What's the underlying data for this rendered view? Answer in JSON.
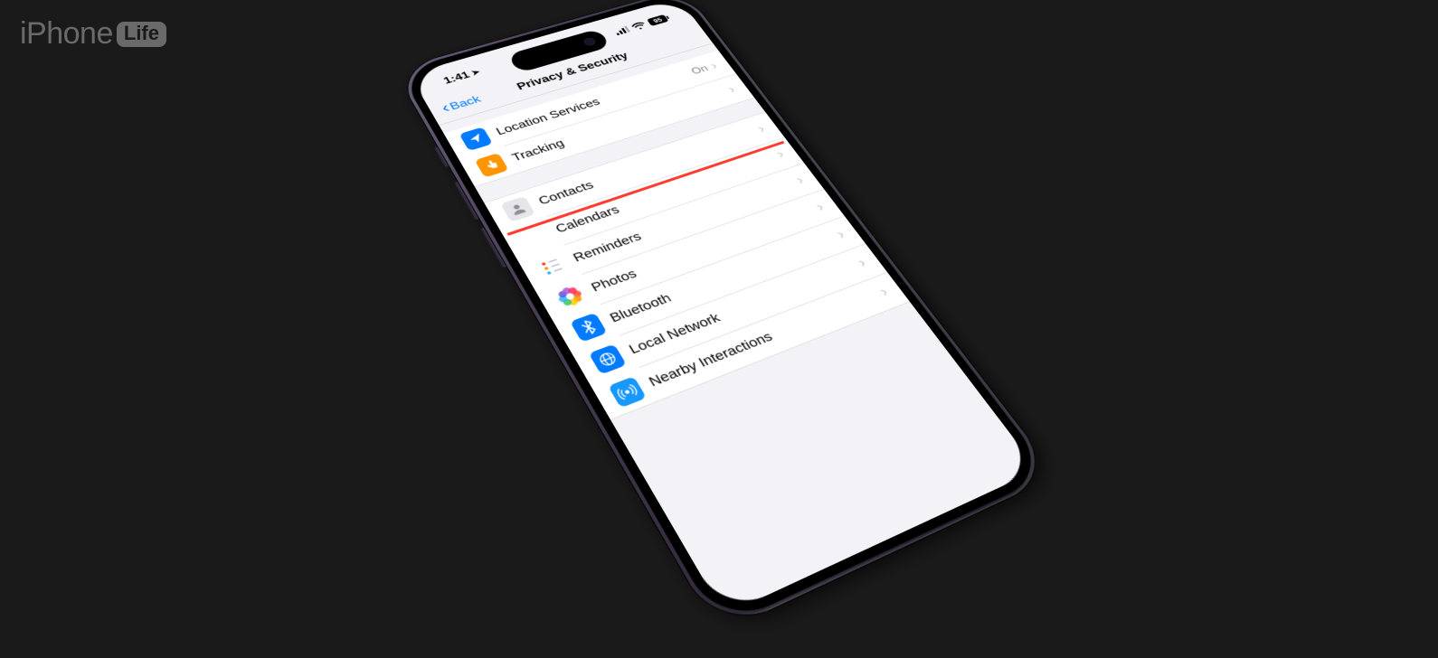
{
  "logo": {
    "brand": "iPhone",
    "badge": "Life"
  },
  "status": {
    "time": "1:41",
    "battery": "95"
  },
  "nav": {
    "back": "Back",
    "title": "Privacy & Security"
  },
  "section1": [
    {
      "id": "location",
      "label": "Location Services",
      "value": "On",
      "icon": "location-arrow-icon",
      "bg": "ic-location"
    },
    {
      "id": "tracking",
      "label": "Tracking",
      "value": "",
      "icon": "hand-icon",
      "bg": "ic-tracking"
    }
  ],
  "section2": [
    {
      "id": "contacts",
      "label": "Contacts",
      "icon": "contacts-icon",
      "bg": "ic-contacts"
    },
    {
      "id": "calendars",
      "label": "Calendars",
      "icon": "calendar-icon",
      "bg": "ic-calendars"
    },
    {
      "id": "reminders",
      "label": "Reminders",
      "icon": "reminders-icon",
      "bg": "ic-reminders"
    },
    {
      "id": "photos",
      "label": "Photos",
      "icon": "photos-icon",
      "bg": "ic-photos"
    },
    {
      "id": "bluetooth",
      "label": "Bluetooth",
      "icon": "bluetooth-icon",
      "bg": "ic-bluetooth"
    },
    {
      "id": "local",
      "label": "Local Network",
      "icon": "local-network-icon",
      "bg": "ic-local"
    },
    {
      "id": "nearby",
      "label": "Nearby Interactions",
      "icon": "nearby-icon",
      "bg": "ic-nearby"
    }
  ]
}
